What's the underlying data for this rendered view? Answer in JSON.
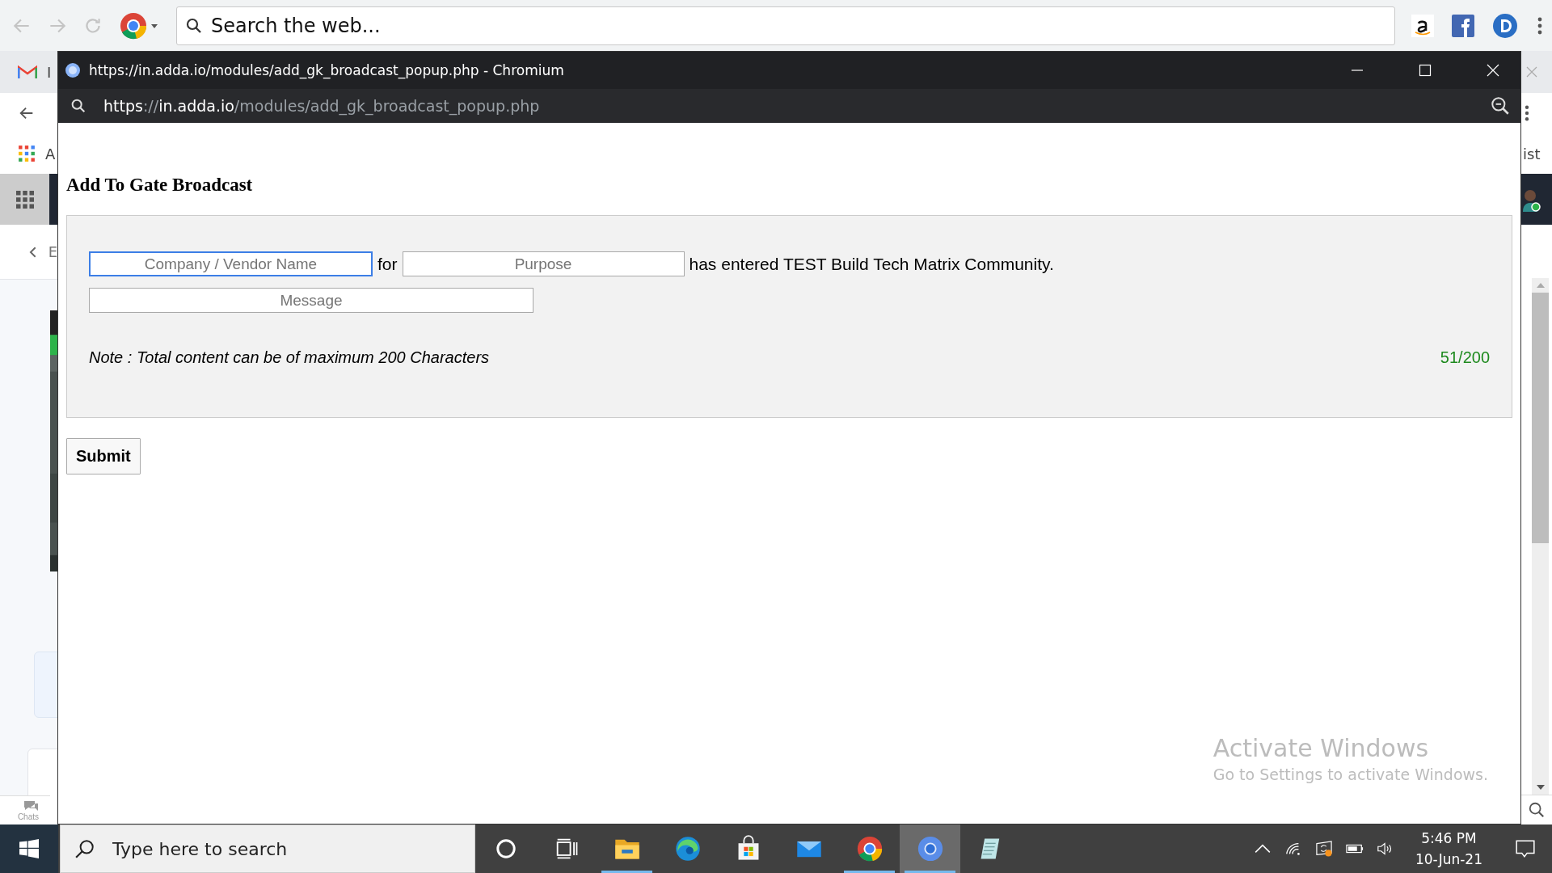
{
  "browser": {
    "search_placeholder": "Search the web...",
    "bookmark_text": "I",
    "apps_text": "A",
    "back_text": "E",
    "right_text": "ist",
    "chats_label": "Chats"
  },
  "popup": {
    "title": "https://in.adda.io/modules/add_gk_broadcast_popup.php - Chromium",
    "url_parts": [
      {
        "text": "https",
        "bright": true
      },
      {
        "text": "://",
        "bright": false
      },
      {
        "text": "in.adda.io",
        "bright": true
      },
      {
        "text": "/modules/add_gk_broadcast_popup.php",
        "bright": false
      }
    ]
  },
  "form": {
    "heading": "Add To Gate Broadcast",
    "fields": [
      {
        "placeholder": "Company / Vendor Name",
        "focused": true
      },
      {
        "placeholder": "Purpose",
        "focused": false
      }
    ],
    "connector": "for",
    "sentence": "has entered TEST Build Tech Matrix Community.",
    "message_placeholder": "Message",
    "note": "Note : Total content can be of maximum 200 Characters",
    "counter": "51/200",
    "submit": "Submit"
  },
  "activation": {
    "title": "Activate Windows",
    "subtitle": "Go to Settings to activate Windows."
  },
  "taskbar": {
    "search_placeholder": "Type here to search",
    "apps": [
      {
        "kind": "cortana",
        "running": false,
        "selected": false
      },
      {
        "kind": "taskview",
        "running": false,
        "selected": false
      },
      {
        "kind": "explorer",
        "running": true,
        "selected": false
      },
      {
        "kind": "edge",
        "running": false,
        "selected": false
      },
      {
        "kind": "store",
        "running": false,
        "selected": false
      },
      {
        "kind": "mail",
        "running": false,
        "selected": false
      },
      {
        "kind": "chrome",
        "running": true,
        "selected": false
      },
      {
        "kind": "chromium",
        "running": true,
        "selected": true
      },
      {
        "kind": "notepad",
        "running": false,
        "selected": false
      }
    ],
    "time": "5:46 PM",
    "date": "10-Jun-21"
  }
}
